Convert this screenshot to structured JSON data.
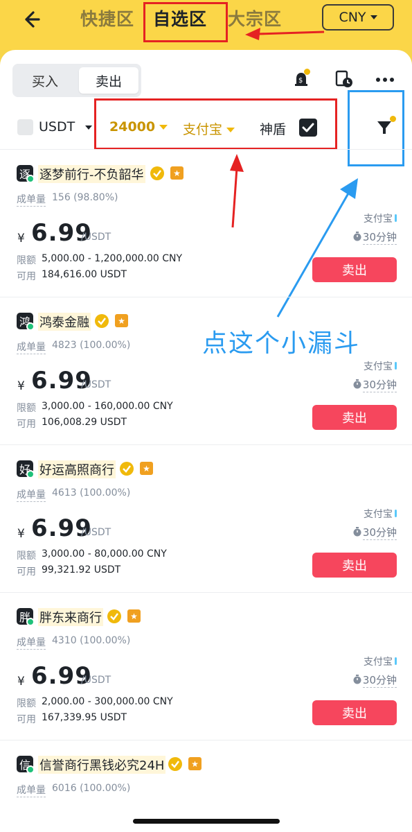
{
  "header": {
    "tabs": [
      "快捷区",
      "自选区",
      "大宗区"
    ],
    "active_tab": "自选区",
    "currency": "CNY"
  },
  "toolbar": {
    "buy_label": "买入",
    "sell_label": "卖出",
    "active": "卖出"
  },
  "filters": {
    "asset": "USDT",
    "amount": "24000",
    "payment": "支付宝",
    "shield_label": "神盾",
    "shield_checked": true
  },
  "annotation": "点这个小漏斗",
  "colors": {
    "brand_yellow": "#fbd648",
    "accent_gold": "#f0b90b",
    "sell_red": "#f6465d",
    "annot_red": "#e52222",
    "annot_blue": "#2a9bf0"
  },
  "ads": [
    {
      "avatar_char": "逐",
      "name": "逐梦前行-不负韶华",
      "orders_label": "成单量",
      "orders": "156 (98.80%)",
      "currency_symbol": "¥",
      "price": "6.99",
      "unit": "/USDT",
      "limit_label": "限额",
      "limit": "5,000.00 - 1,200,000.00 CNY",
      "avail_label": "可用",
      "available": "184,616.00 USDT",
      "payment": "支付宝",
      "time": "30分钟",
      "button": "卖出"
    },
    {
      "avatar_char": "鸿",
      "name": "鸿泰金融",
      "orders_label": "成单量",
      "orders": "4823 (100.00%)",
      "currency_symbol": "¥",
      "price": "6.99",
      "unit": "/USDT",
      "limit_label": "限额",
      "limit": "3,000.00 - 160,000.00 CNY",
      "avail_label": "可用",
      "available": "106,008.29 USDT",
      "payment": "支付宝",
      "time": "30分钟",
      "button": "卖出"
    },
    {
      "avatar_char": "好",
      "name": "好运高照商行",
      "orders_label": "成单量",
      "orders": "4613 (100.00%)",
      "currency_symbol": "¥",
      "price": "6.99",
      "unit": "/USDT",
      "limit_label": "限额",
      "limit": "3,000.00 - 80,000.00 CNY",
      "avail_label": "可用",
      "available": "99,321.92 USDT",
      "payment": "支付宝",
      "time": "30分钟",
      "button": "卖出"
    },
    {
      "avatar_char": "胖",
      "name": "胖东来商行",
      "orders_label": "成单量",
      "orders": "4310 (100.00%)",
      "currency_symbol": "¥",
      "price": "6.99",
      "unit": "/USDT",
      "limit_label": "限额",
      "limit": "2,000.00 - 300,000.00 CNY",
      "avail_label": "可用",
      "available": "167,339.95 USDT",
      "payment": "支付宝",
      "time": "30分钟",
      "button": "卖出"
    },
    {
      "avatar_char": "信",
      "name": "信誉商行黑钱必究24H",
      "orders_label": "成单量",
      "orders": "6016 (100.00%)"
    }
  ]
}
